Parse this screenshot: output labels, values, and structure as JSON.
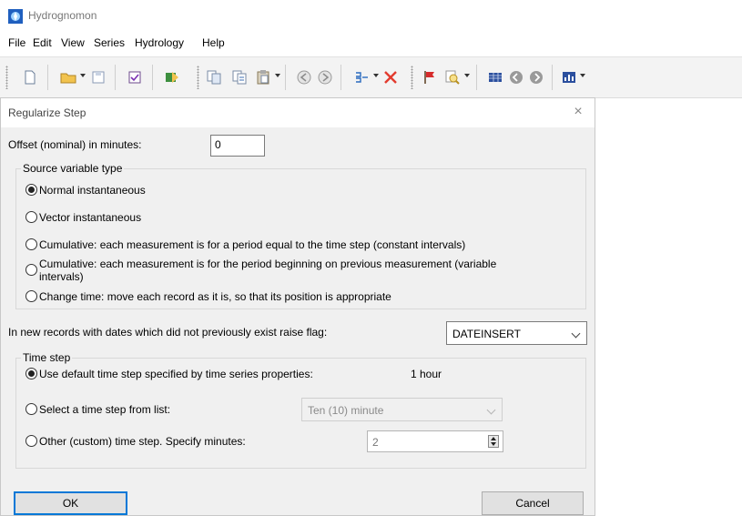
{
  "app": {
    "title": "Hydrognomon",
    "menu": [
      "File",
      "Edit",
      "View",
      "Series",
      "Hydrology",
      "Help"
    ]
  },
  "dialog": {
    "title": "Regularize Step",
    "close_symbol": "×",
    "offset": {
      "label": "Offset (nominal) in minutes:",
      "value": "0"
    },
    "source_group": {
      "caption": "Source variable type",
      "options": [
        {
          "label": "Normal instantaneous",
          "checked": true
        },
        {
          "label": "Vector instantaneous",
          "checked": false
        },
        {
          "label": "Cumulative: each measurement is for a period equal to the time step (constant intervals)",
          "checked": false
        },
        {
          "label": "Cumulative: each measurement is for the period beginning on previous measurement (variable",
          "label2": "intervals)",
          "checked": false
        },
        {
          "label": "Change time: move each record as it is, so that its position is appropriate",
          "checked": false
        }
      ]
    },
    "flag": {
      "label": "In new records with dates which did not previously exist raise flag:",
      "value": "DATEINSERT"
    },
    "timestep_group": {
      "caption": "Time step",
      "default_option": {
        "label": "Use default time step specified by time series properties:",
        "value": "1 hour",
        "checked": true
      },
      "list_option": {
        "label": "Select a time step from list:",
        "value": "Ten (10) minute",
        "checked": false
      },
      "custom_option": {
        "label": "Other (custom) time step. Specify minutes:",
        "value": "2",
        "checked": false
      }
    },
    "buttons": {
      "ok": "OK",
      "cancel": "Cancel"
    }
  }
}
